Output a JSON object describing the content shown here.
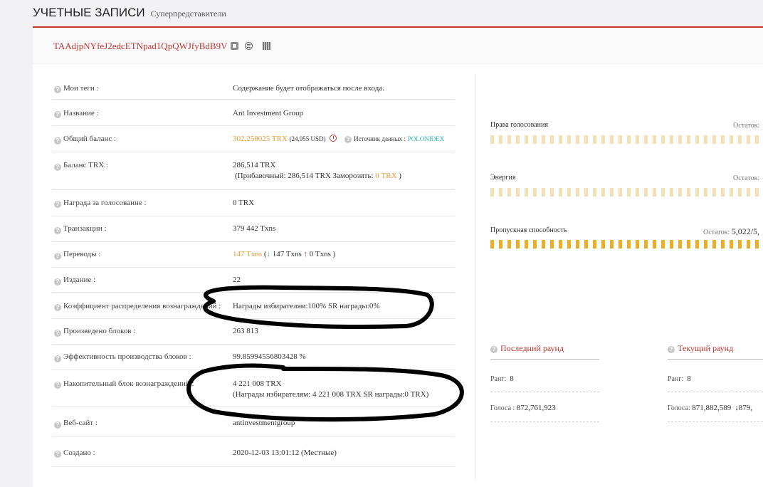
{
  "header": {
    "title": "УЧЕТНЫЕ ЗАПИСИ",
    "subtitle": "Суперпредставители"
  },
  "account": {
    "address": "TAAdjpNYfeJ2edcETNpad1QpQWJfyBdB9V"
  },
  "rows": {
    "tags": {
      "label": "Мои теги :",
      "value": "Содержание будет отображаться после входа."
    },
    "name": {
      "label": "Название :",
      "value": "Ant Investment Group"
    },
    "balance": {
      "label": "Общий баланс  :",
      "value": "302,258025 TRX",
      "usd": "(24,955 USD)",
      "source_label": "Источник данных :",
      "source": "POLONIDEX"
    },
    "trx_balance": {
      "label": "Баланс TRX :",
      "value": "286,514 TRX",
      "detail_prefix": "(Прибавочный: 286,514 TRX  Заморозить:",
      "frozen": "0 TRX",
      "detail_suffix": ")"
    },
    "vote_reward": {
      "label": "Награда за голосование :",
      "value": "0 TRX"
    },
    "transactions": {
      "label": "Транзакции  :",
      "value": "379 442 Txns"
    },
    "transfers": {
      "label": "Переводы  :",
      "value": "147 Txns",
      "open": "(",
      "in": "147 Txns",
      "out": "0 Txns",
      "close": ")"
    },
    "version": {
      "label": "Издание :",
      "value": "22"
    },
    "ratio": {
      "label": "Коэффициент распределения вознаграждений  :",
      "value": "Награды избирателям:100% SR награды:0%"
    },
    "blocks": {
      "label": "Произведено блоков :",
      "value": "263 813"
    },
    "efficiency": {
      "label": "Эффективность производства блоков  :",
      "value": "99.85994556803428 %"
    },
    "accum": {
      "label": "Накопительный блок вознаграждений  :",
      "value": "4 221 008 TRX",
      "detail": "(Награды избирателям: 4 221 008 TRX SR награды:0 TRX)"
    },
    "website": {
      "label": "Веб-сайт :",
      "value": "antinvestmentgroup"
    },
    "created": {
      "label": "Создано  :",
      "value": "2020-12-03 13:01:12 (Местные)"
    }
  },
  "resources": {
    "voting": {
      "label": "Права голосования",
      "rest_label": "Остаток:"
    },
    "energy": {
      "label": "Энергия",
      "rest_label": "Остаток:"
    },
    "bandwidth": {
      "label": "Пропускная способность",
      "rest_label": "Остаток:",
      "rest_value": "5,022/5,"
    }
  },
  "last_round": {
    "title": "Последний раунд",
    "rank_label": "Ранг:",
    "rank": "8",
    "votes_label": "Голоса :",
    "votes": "872,761,923"
  },
  "current_round": {
    "title": "Текущий раунд",
    "rank_label": "Ранг:",
    "rank": "8",
    "votes_label": "Голоса:",
    "votes": "871,882,589",
    "change": "879,"
  },
  "colors": {
    "accent": "#c23631",
    "orange": "#e99b37",
    "teal": "#2ab7a9",
    "bar": "#f0ac24"
  }
}
